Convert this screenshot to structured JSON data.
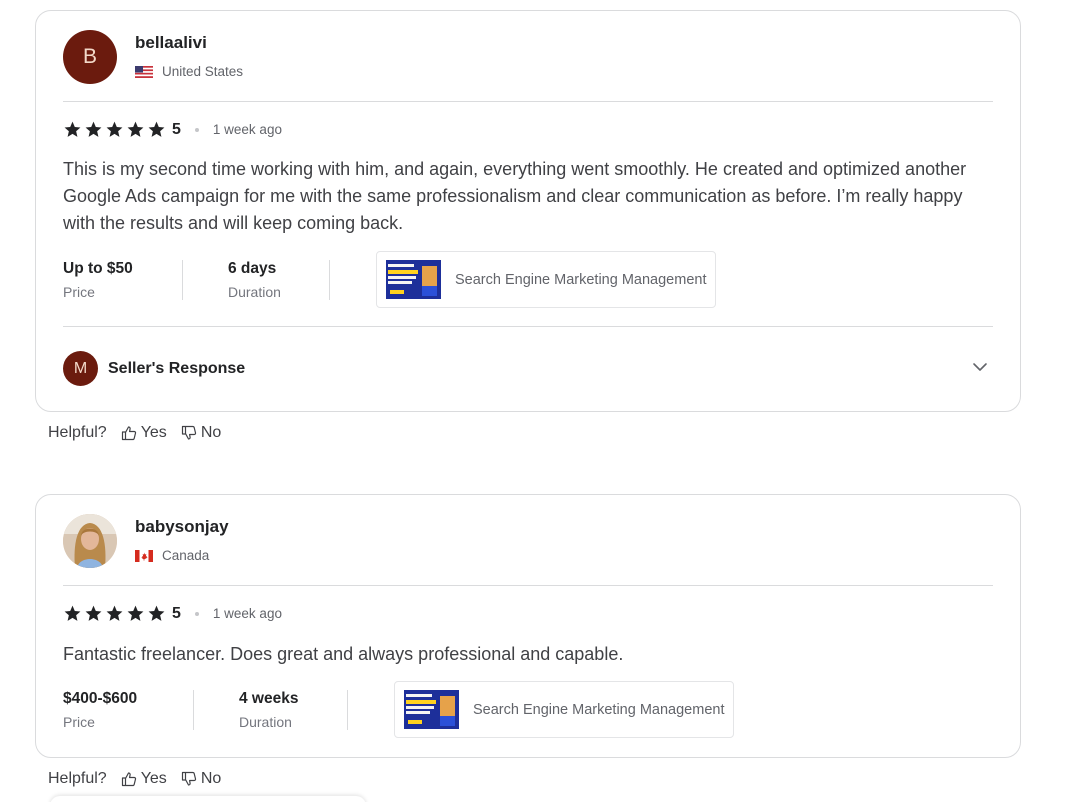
{
  "reviews": [
    {
      "avatar_letter": "B",
      "username": "bellaalivi",
      "country": "United States",
      "rating": "5",
      "time": "1 week ago",
      "text": "This is my second time working with him, and again, everything went smoothly. He created and optimized another Google Ads campaign for me with the same professionalism and clear communication as before. I’m really happy with the results and will keep coming back.",
      "price_value": "Up to $50",
      "price_label": "Price",
      "duration_value": "6 days",
      "duration_label": "Duration",
      "gig_title": "Search Engine Marketing Management",
      "seller_response": {
        "avatar_letter": "M",
        "label": "Seller's Response"
      }
    },
    {
      "avatar_icon": "profile-photo",
      "username": "babysonjay",
      "country": "Canada",
      "rating": "5",
      "time": "1 week ago",
      "text": "Fantastic freelancer. Does great and always professional and capable.",
      "price_value": "$400-$600",
      "price_label": "Price",
      "duration_value": "4 weeks",
      "duration_label": "Duration",
      "gig_title": "Search Engine Marketing Management"
    }
  ],
  "helpful": {
    "label": "Helpful?",
    "yes": "Yes",
    "no": "No"
  },
  "colors": {
    "avatar_bg": "#6b1b0e",
    "star": "#222325",
    "text_muted": "#62646a",
    "border": "#dadbdd"
  }
}
